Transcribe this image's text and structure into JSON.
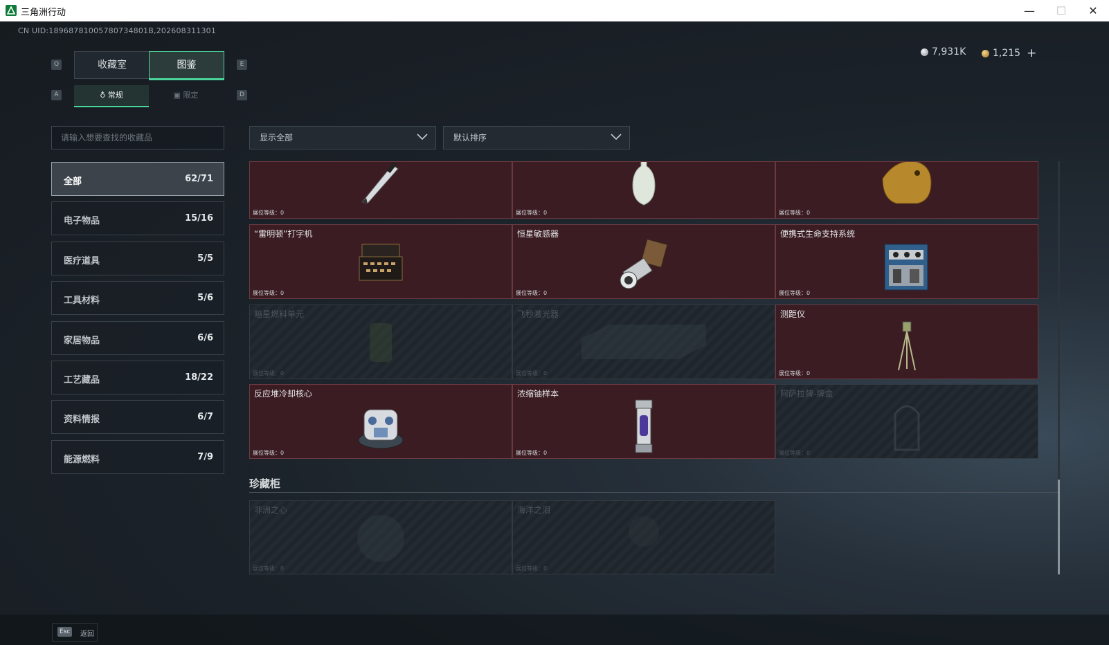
{
  "window": {
    "title": "三角洲行动",
    "minimize": "—",
    "maximize": "☐",
    "close": "✕"
  },
  "uid": "CN UID:18968781005780734801B,202608311301",
  "currency": {
    "silver": "7,931K",
    "gold": "1,215",
    "plus": "+"
  },
  "keys": {
    "q": "Q",
    "e": "E",
    "a": "A",
    "d": "D"
  },
  "tabs": {
    "collection": "收藏室",
    "catalog": "图鉴"
  },
  "subtabs": {
    "regular": "常规",
    "limited": "限定"
  },
  "search": {
    "placeholder": "请输入想要查找的收藏品"
  },
  "filters": {
    "show": "显示全部",
    "sort": "默认排序"
  },
  "categories": [
    {
      "name": "全部",
      "count": "62/71"
    },
    {
      "name": "电子物品",
      "count": "15/16"
    },
    {
      "name": "医疗道具",
      "count": "5/5"
    },
    {
      "name": "工具材料",
      "count": "5/6"
    },
    {
      "name": "家居物品",
      "count": "6/6"
    },
    {
      "name": "工艺藏品",
      "count": "18/22"
    },
    {
      "name": "资料情报",
      "count": "6/7"
    },
    {
      "name": "能源燃料",
      "count": "7/9"
    }
  ],
  "level_label": "展位等级：0",
  "items": [
    {
      "name": "",
      "owned": true,
      "icon": "pen-icon"
    },
    {
      "name": "",
      "owned": true,
      "icon": "vase-icon"
    },
    {
      "name": "",
      "owned": true,
      "icon": "golden-statue-icon"
    },
    {
      "name": "“雷明顿”打字机",
      "owned": true,
      "icon": "typewriter-icon"
    },
    {
      "name": "恒星敏感器",
      "owned": true,
      "icon": "star-sensor-icon"
    },
    {
      "name": "便携式生命支持系统",
      "owned": true,
      "icon": "life-support-icon"
    },
    {
      "name": "暗星燃料单元",
      "owned": false,
      "icon": "fuel-cell-icon"
    },
    {
      "name": "飞秒激光器",
      "owned": false,
      "icon": "laser-icon"
    },
    {
      "name": "测距仪",
      "owned": true,
      "icon": "rangefinder-icon"
    },
    {
      "name": "反应堆冷却核心",
      "owned": true,
      "icon": "reactor-core-icon"
    },
    {
      "name": "浓缩铀样本",
      "owned": true,
      "icon": "uranium-sample-icon"
    },
    {
      "name": "阿萨拉牌-牌盒",
      "owned": false,
      "icon": "card-box-icon"
    }
  ],
  "section_title": "珍藏柜",
  "cabinet": [
    {
      "name": "非洲之心",
      "owned": false,
      "icon": "gem-icon"
    },
    {
      "name": "海洋之泪",
      "owned": false,
      "icon": "pearl-icon"
    }
  ],
  "footer": {
    "esc_key": "Esc",
    "back": "返回"
  }
}
